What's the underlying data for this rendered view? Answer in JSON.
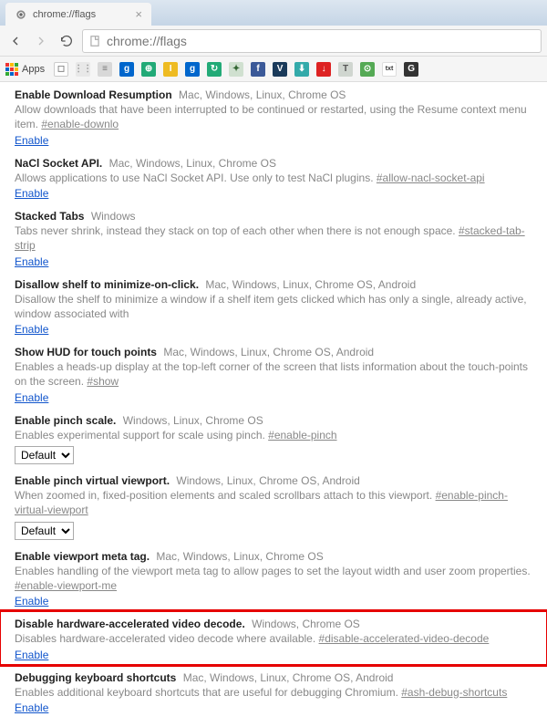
{
  "tab": {
    "title": "chrome://flags",
    "close": "×"
  },
  "omnibox": {
    "url": "chrome://flags"
  },
  "bookmarks": {
    "apps_label": "Apps"
  },
  "flags": [
    {
      "name": "Enable Download Resumption",
      "platforms": "Mac, Windows, Linux, Chrome OS",
      "desc": "Allow downloads that have been interrupted to be continued or restarted, using the Resume context menu item.",
      "anchor": "#enable-downlo",
      "action": "Enable",
      "control": "link"
    },
    {
      "name": "NaCl Socket API.",
      "platforms": "Mac, Windows, Linux, Chrome OS",
      "desc": "Allows applications to use NaCl Socket API. Use only to test NaCl plugins.",
      "anchor": "#allow-nacl-socket-api",
      "action": "Enable",
      "control": "link"
    },
    {
      "name": "Stacked Tabs",
      "platforms": "Windows",
      "desc": "Tabs never shrink, instead they stack on top of each other when there is not enough space.",
      "anchor": "#stacked-tab-strip",
      "action": "Enable",
      "control": "link"
    },
    {
      "name": "Disallow shelf to minimize-on-click.",
      "platforms": "Mac, Windows, Linux, Chrome OS, Android",
      "desc": "Disallow the shelf to minimize a window if a shelf item gets clicked which has only a single, already active, window associated with",
      "anchor": "",
      "action": "Enable",
      "control": "link"
    },
    {
      "name": "Show HUD for touch points",
      "platforms": "Mac, Windows, Linux, Chrome OS, Android",
      "desc": "Enables a heads-up display at the top-left corner of the screen that lists information about the touch-points on the screen.",
      "anchor": "#show",
      "action": "Enable",
      "control": "link"
    },
    {
      "name": "Enable pinch scale.",
      "platforms": "Windows, Linux, Chrome OS",
      "desc": "Enables experimental support for scale using pinch.",
      "anchor": "#enable-pinch",
      "action": "Default",
      "control": "select"
    },
    {
      "name": "Enable pinch virtual viewport.",
      "platforms": "Windows, Linux, Chrome OS, Android",
      "desc": "When zoomed in, fixed-position elements and scaled scrollbars attach to this viewport.",
      "anchor": "#enable-pinch-virtual-viewport",
      "action": "Default",
      "control": "select"
    },
    {
      "name": "Enable viewport meta tag.",
      "platforms": "Mac, Windows, Linux, Chrome OS",
      "desc": "Enables handling of the viewport meta tag to allow pages to set the layout width and user zoom properties.",
      "anchor": "#enable-viewport-me",
      "action": "Enable",
      "control": "link"
    },
    {
      "name": "Disable hardware-accelerated video decode.",
      "platforms": "Windows, Chrome OS",
      "desc": "Disables hardware-accelerated video decode where available.",
      "anchor": "#disable-accelerated-video-decode",
      "action": "Enable",
      "control": "link",
      "highlight": true
    },
    {
      "name": "Debugging keyboard shortcuts",
      "platforms": "Mac, Windows, Linux, Chrome OS, Android",
      "desc": "Enables additional keyboard shortcuts that are useful for debugging Chromium.",
      "anchor": "#ash-debug-shortcuts",
      "action": "Enable",
      "control": "link"
    }
  ]
}
